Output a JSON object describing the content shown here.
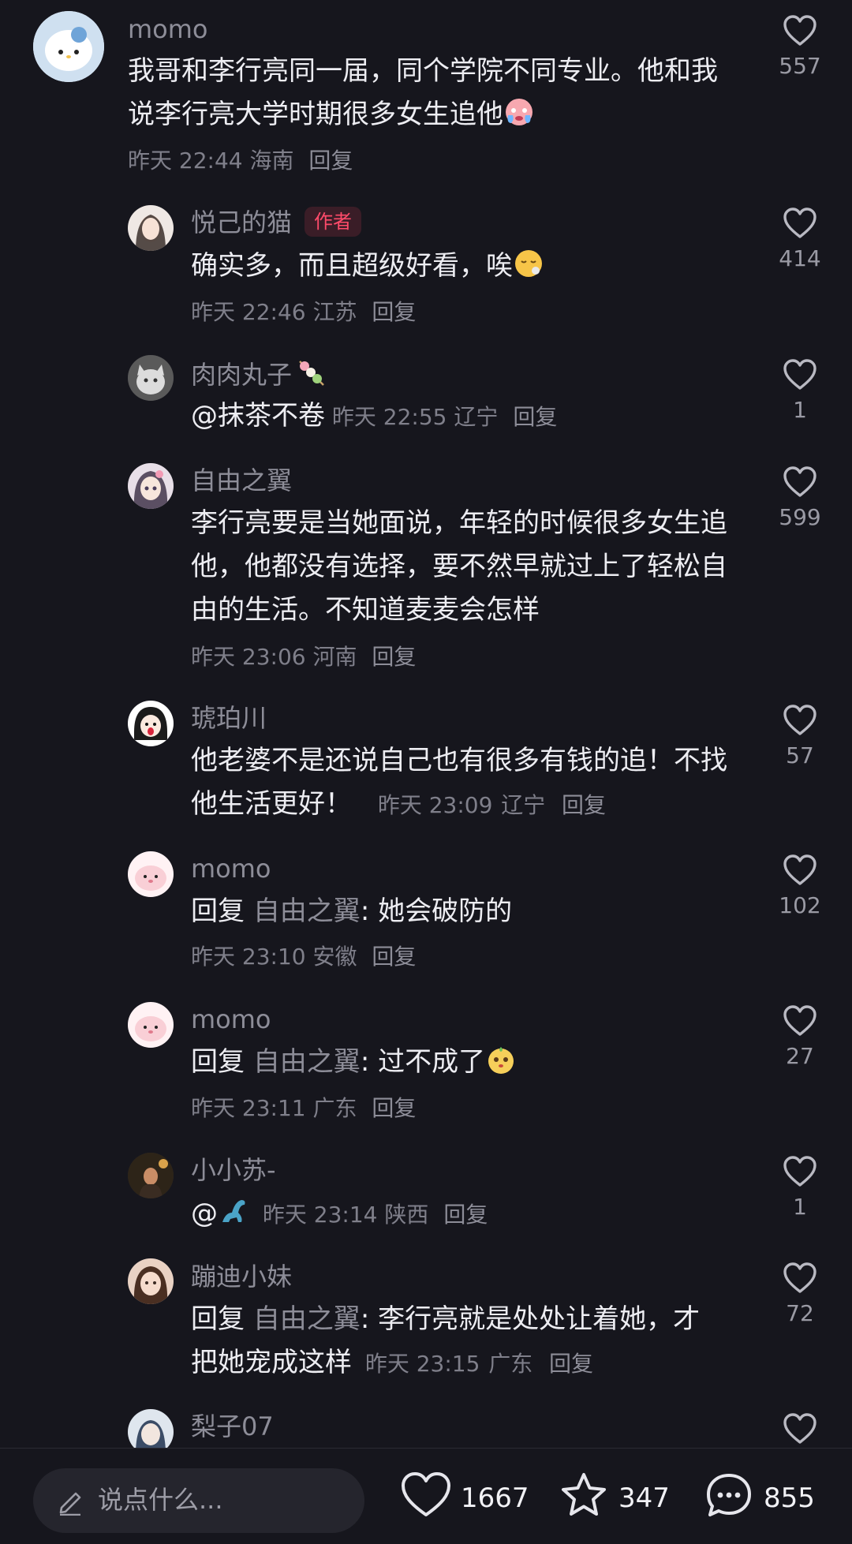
{
  "comments": [
    {
      "username": "momo",
      "text": "我哥和李行亮同一届，同个学院不同专业。他和我说李行亮大学时期很多女生追他",
      "emoji": "crying-face",
      "time": "昨天 22:44",
      "location": "海南",
      "reply_label": "回复",
      "likes": "557"
    },
    {
      "username": "悦己的猫",
      "badge": "作者",
      "text": "确实多，而且超级好看，唉",
      "emoji": "sigh-face",
      "time": "昨天 22:46",
      "location": "江苏",
      "reply_label": "回复",
      "likes": "414"
    },
    {
      "username": "肉肉丸子",
      "mention": "@抹茶不卷",
      "time": "昨天 22:55",
      "location": "辽宁",
      "reply_label": "回复",
      "likes": "1"
    },
    {
      "username": "自由之翼",
      "text": "李行亮要是当她面说，年轻的时候很多女生追他，他都没有选择，要不然早就过上了轻松自由的生活。不知道麦麦会怎样",
      "time": "昨天 23:06",
      "location": "河南",
      "reply_label": "回复",
      "likes": "599"
    },
    {
      "username": "琥珀川",
      "text": "他老婆不是还说自己也有很多有钱的追！不找他生活更好！",
      "time": "昨天 23:09",
      "location": "辽宁",
      "reply_label": "回复",
      "likes": "57"
    },
    {
      "username": "momo",
      "reply_prefix": "回复",
      "reply_to": "自由之翼",
      "text": "她会破防的",
      "time": "昨天 23:10",
      "location": "安徽",
      "reply_label": "回复",
      "likes": "102"
    },
    {
      "username": "momo",
      "reply_prefix": "回复",
      "reply_to": "自由之翼",
      "text": "过不成了",
      "emoji": "cute-face",
      "time": "昨天 23:11",
      "location": "广东",
      "reply_label": "回复",
      "likes": "27"
    },
    {
      "username": "小小苏-",
      "mention": "@",
      "mention_emoji": "dinosaur",
      "time": "昨天 23:14",
      "location": "陕西",
      "reply_label": "回复",
      "likes": "1"
    },
    {
      "username": "蹦迪小妹",
      "reply_prefix": "回复",
      "reply_to": "自由之翼",
      "text_line1": "李行亮就是处处让着她，才",
      "text_line2": "把她宠成这样",
      "time": "昨天 23:15",
      "location": "广东",
      "reply_label": "回复",
      "likes": "72"
    },
    {
      "username": "梨子07"
    }
  ],
  "bottom_bar": {
    "input_placeholder": "说点什么...",
    "likes_total": "1667",
    "stars_total": "347",
    "comments_total": "855"
  },
  "colors": {
    "background": "#16161d",
    "author_badge": "#ff4b6a",
    "muted": "#7f7f8a"
  }
}
